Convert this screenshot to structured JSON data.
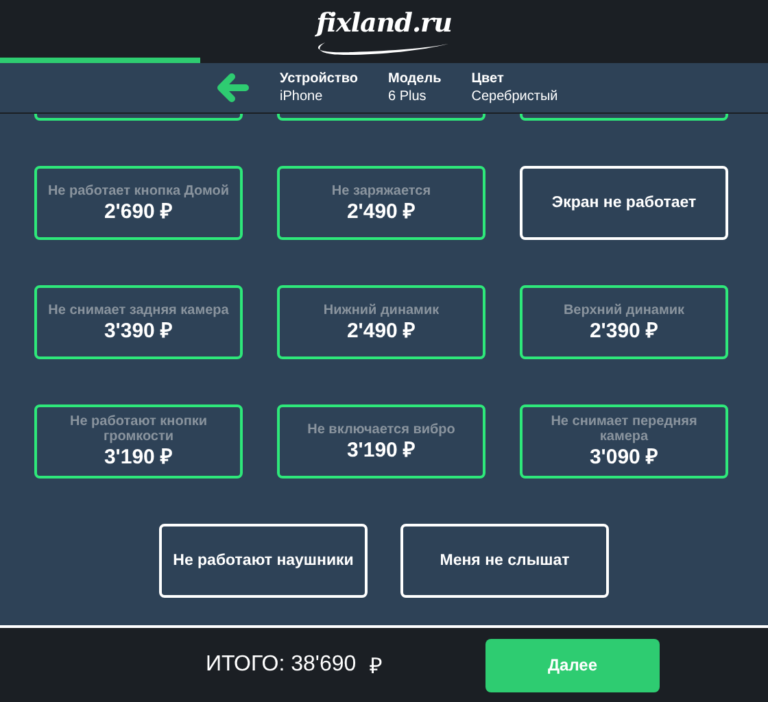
{
  "header": {
    "logo": "fixland.ru",
    "progress": {
      "level": 0.26
    }
  },
  "device_info": [
    {
      "label": "Устройство",
      "value": "iPhone"
    },
    {
      "label": "Модель",
      "value": "6 Plus"
    },
    {
      "label": "Цвет",
      "value": "Серебристый"
    }
  ],
  "hidden_row": [
    {
      "selected": true
    },
    {
      "selected": true
    },
    {
      "selected": true
    }
  ],
  "problems": [
    {
      "label": "Не работает кнопка Домой",
      "price": "2'690 ₽",
      "selected": true
    },
    {
      "label": "Не заряжается",
      "price": "2'490 ₽",
      "selected": true
    },
    {
      "label": "Экран не работает",
      "selected": false
    },
    {
      "label": "Не снимает задняя камера",
      "price": "3'390 ₽",
      "selected": true
    },
    {
      "label": "Нижний динамик",
      "price": "2'490 ₽",
      "selected": true
    },
    {
      "label": "Верхний динамик",
      "price": "2'390 ₽",
      "selected": true
    },
    {
      "label": "Не работают кнопки громкости",
      "price": "3'190 ₽",
      "selected": true
    },
    {
      "label": "Не включается вибро",
      "price": "3'190 ₽",
      "selected": true
    },
    {
      "label": "Не снимает передняя камера",
      "price": "3'090 ₽",
      "selected": true
    },
    {
      "label": "Не работают наушники",
      "selected": false
    },
    {
      "label": "Меня не слышат",
      "selected": false
    }
  ],
  "footer": {
    "total": "ИТОГО: 38'690",
    "currency": "₽",
    "next_button": "Далее"
  }
}
